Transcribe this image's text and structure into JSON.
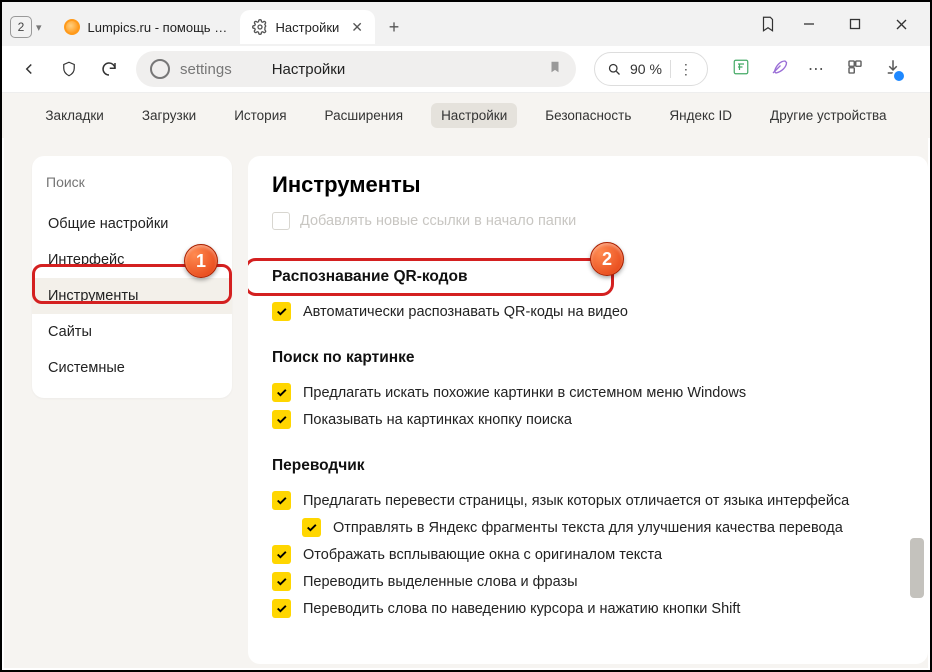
{
  "titlebar": {
    "tab_count": "2",
    "tab1_label": "Lumpics.ru - помощь с ком",
    "tab2_label": "Настройки"
  },
  "addressbar": {
    "url_text": "settings",
    "page_title": "Настройки",
    "zoom": "90 %"
  },
  "topnav": {
    "items": [
      "Закладки",
      "Загрузки",
      "История",
      "Расширения",
      "Настройки",
      "Безопасность",
      "Яндекс ID",
      "Другие устройства"
    ],
    "active_index": 4
  },
  "sidebar": {
    "search_placeholder": "Поиск",
    "items": [
      "Общие настройки",
      "Интерфейс",
      "Инструменты",
      "Сайты",
      "Системные"
    ],
    "active_index": 2
  },
  "content": {
    "heading": "Инструменты",
    "faded_row": "Добавлять новые ссылки в начало папки",
    "qr": {
      "title": "Распознавание QR-кодов",
      "item": "Автоматически распознавать QR-коды на видео"
    },
    "imgsearch": {
      "title": "Поиск по картинке",
      "items": [
        "Предлагать искать похожие картинки в системном меню Windows",
        "Показывать на картинках кнопку поиска"
      ]
    },
    "translator": {
      "title": "Переводчик",
      "items": [
        "Предлагать перевести страницы, язык которых отличается от языка интерфейса",
        "Отправлять в Яндекс фрагменты текста для улучшения качества перевода",
        "Отображать всплывающие окна с оригиналом текста",
        "Переводить выделенные слова и фразы",
        "Переводить слова по наведению курсора и нажатию кнопки Shift"
      ]
    }
  },
  "badges": {
    "one": "1",
    "two": "2"
  }
}
